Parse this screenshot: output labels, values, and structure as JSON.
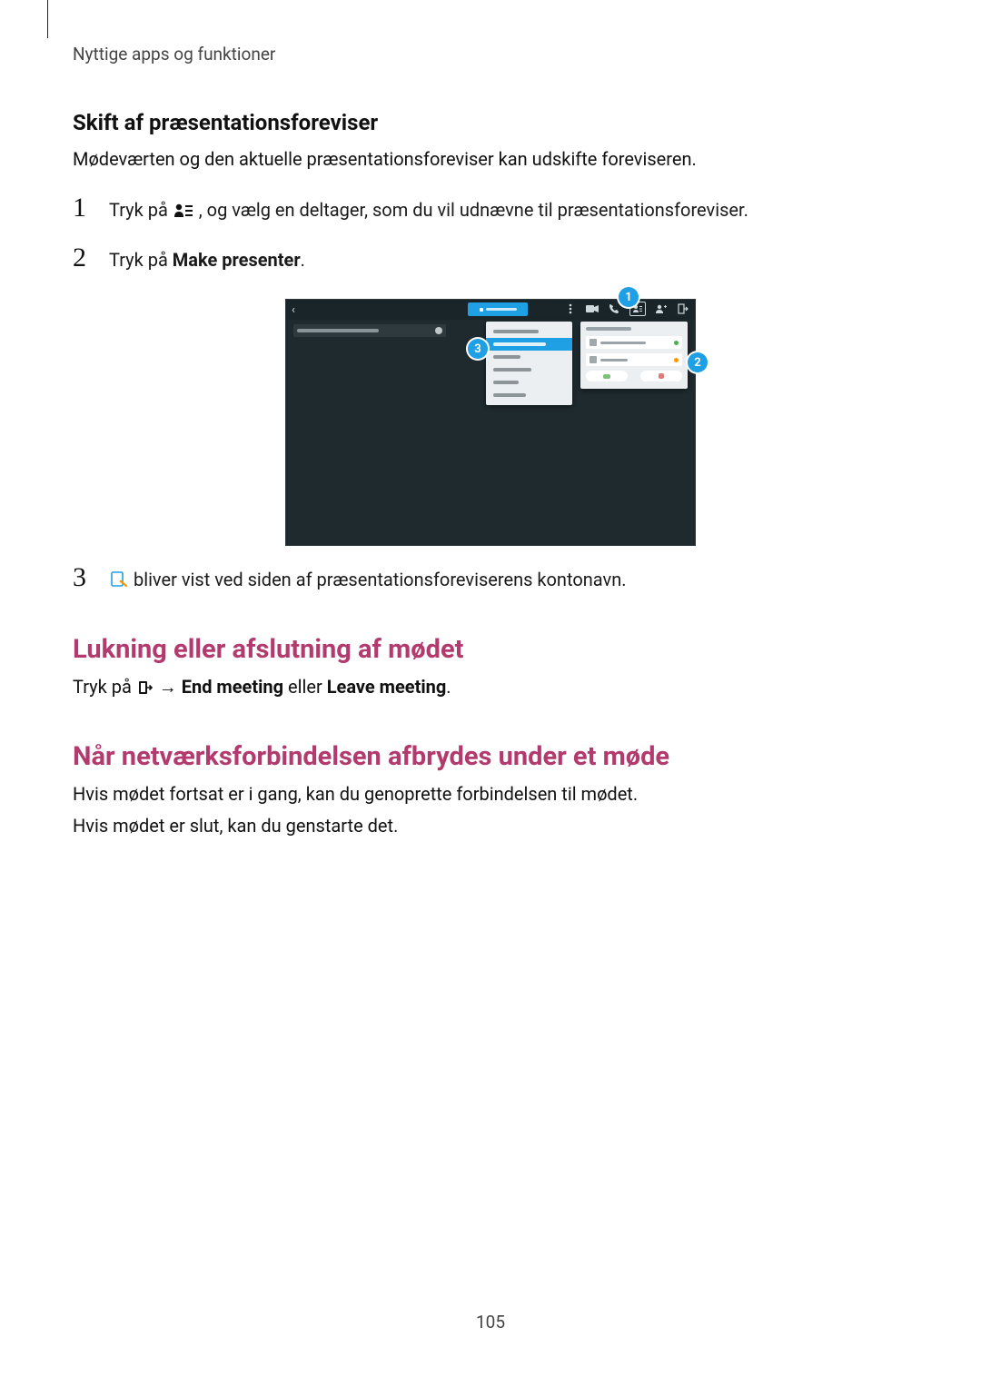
{
  "running_head": "Nyttige apps og funktioner",
  "section1": {
    "heading": "Skift af præsentationsforeviser",
    "intro": "Mødeværten og den aktuelle præsentationsforeviser kan udskifte foreviseren.",
    "steps": {
      "n1": "1",
      "s1a": "Tryk på ",
      "s1b": ", og vælg en deltager, som du vil udnævne til præsentationsforeviser.",
      "n2": "2",
      "s2a": "Tryk på ",
      "s2b_bold": "Make presenter",
      "s2c": ".",
      "n3": "3",
      "s3b": " bliver vist ved siden af præsentationsforeviserens kontonavn."
    }
  },
  "figure": {
    "callout1": "1",
    "callout2": "2",
    "callout3": "3",
    "icons": {
      "back": "chevron-left-icon",
      "share": "share-screen-icon",
      "overflow": "overflow-menu-icon",
      "video": "videocam-icon",
      "call": "call-icon",
      "participants": "participants-list-icon",
      "add_person": "add-person-icon",
      "exit": "exit-icon"
    }
  },
  "section2": {
    "heading": "Lukning eller afslutning af mødet",
    "p_a": "Tryk på ",
    "p_b": " → ",
    "p_c_bold": "End meeting",
    "p_d": " eller ",
    "p_e_bold": "Leave meeting",
    "p_f": "."
  },
  "section3": {
    "heading": "Når netværksforbindelsen afbrydes under et møde",
    "p1": "Hvis mødet fortsat er i gang, kan du genoprette forbindelsen til mødet.",
    "p2": "Hvis mødet er slut, kan du genstarte det."
  },
  "page_number": "105"
}
